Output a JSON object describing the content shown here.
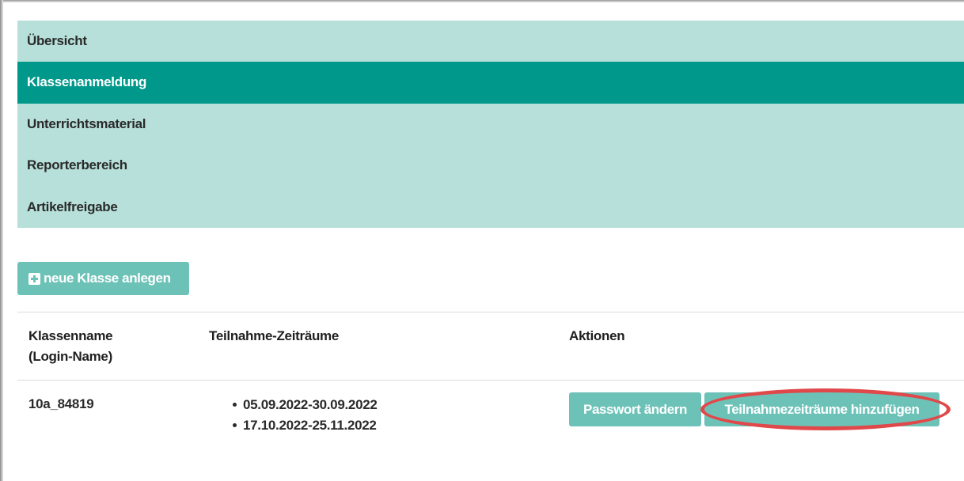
{
  "nav": {
    "items": [
      {
        "label": "Übersicht"
      },
      {
        "label": "Klassenanmeldung"
      },
      {
        "label": "Unterrichtsmaterial"
      },
      {
        "label": "Reporterbereich"
      },
      {
        "label": "Artikelfreigabe"
      }
    ],
    "active_index": 1
  },
  "toolbar": {
    "add_class_label": "neue Klasse anlegen",
    "add_icon": "plus-square-icon"
  },
  "table": {
    "headers": {
      "class_name_line1": "Klassenname",
      "class_name_line2": "(Login-Name)",
      "periods": "Teilnahme-Zeiträume",
      "actions": "Aktionen"
    },
    "rows": [
      {
        "class_name": "10a_84819",
        "periods": [
          "05.09.2022-30.09.2022",
          "17.10.2022-25.11.2022"
        ],
        "actions": {
          "change_password": "Passwort ändern",
          "add_periods": "Teilnahmezeiträume hinzufügen"
        }
      }
    ]
  },
  "colors": {
    "nav_bg": "#b7e0da",
    "nav_active": "#00988a",
    "button": "#6dc2b8",
    "highlight": "#e0484a"
  }
}
